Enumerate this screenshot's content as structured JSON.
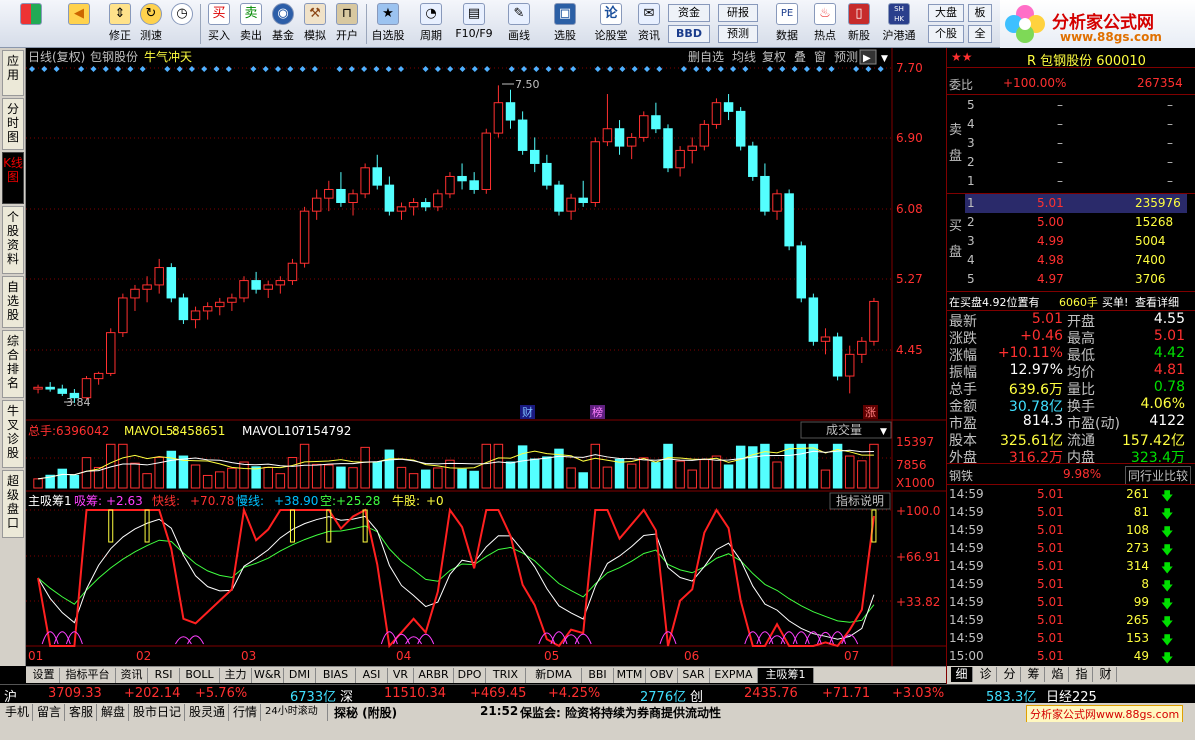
{
  "toolbar": {
    "items": [
      {
        "label": "",
        "icon": "home-grid-icon"
      },
      {
        "label": "",
        "icon": "back-arrow-icon"
      },
      {
        "label": "修正",
        "icon": "arrow-up-icon"
      },
      {
        "label": "测速",
        "icon": "speed-icon"
      },
      {
        "label": "买入",
        "icon": "buy-icon"
      },
      {
        "label": "卖出",
        "icon": "sell-icon"
      },
      {
        "label": "基金",
        "icon": "fund-icon"
      },
      {
        "label": "模拟",
        "icon": "hammer-icon"
      },
      {
        "label": "开户",
        "icon": "lock-icon"
      },
      {
        "label": "自选股",
        "icon": "favorites-icon"
      },
      {
        "label": "周期",
        "icon": "clock-icon"
      },
      {
        "label": "F10/F9",
        "icon": "f10-icon"
      },
      {
        "label": "画线",
        "icon": "pen-icon"
      },
      {
        "label": "选股",
        "icon": "screen-icon"
      },
      {
        "label": "论股堂",
        "icon": "forum-icon"
      },
      {
        "label": "资讯",
        "icon": "news-icon"
      },
      {
        "label": "数据",
        "icon": "data-icon"
      },
      {
        "label": "热点",
        "icon": "fire-icon"
      },
      {
        "label": "新股",
        "icon": "newstock-icon"
      },
      {
        "label": "沪港通",
        "icon": "hk-connect-icon"
      }
    ],
    "small_buttons": [
      "资金",
      "BBD",
      "研报",
      "预测",
      "大盘",
      "个股",
      "板",
      "全"
    ],
    "buy_glyph": "买",
    "sell_glyph": "卖",
    "forum_glyph": "论",
    "hk_glyph": "SH HK",
    "pe_glyph": "PE",
    "bbd_glyph": "BBD"
  },
  "logo": {
    "title": "分析家公式网",
    "url": "www.88gs.com"
  },
  "left_tabs": [
    "应用",
    "分时图",
    "K线图",
    "个股资料",
    "自选股",
    "综合排名",
    "牛叉诊股",
    "超级盘口"
  ],
  "chart": {
    "header_left": "日线(复权)",
    "stock_name": "包钢股份",
    "signal": "牛气冲天",
    "header_right_buttons": [
      "删自选",
      "均线",
      "复权",
      "叠",
      "窗",
      "预测"
    ],
    "high_marker": "7.50",
    "low_marker": "3.84",
    "price_ticks": [
      "7.70",
      "6.90",
      "6.08",
      "5.27",
      "4.45"
    ],
    "event_labels": [
      "财",
      "榜",
      "涨"
    ],
    "volume_header": {
      "label": "总手:",
      "value": "6396042",
      "mavol5_label": "MAVOL5:",
      "mavol5": "8458651",
      "mavol10_label": "MAVOL10:",
      "mavol10": "7154792",
      "dropdown": "成交量"
    },
    "volume_ticks": [
      "15397",
      "7856",
      "X1000"
    ],
    "indicator_header": {
      "name": "主吸筹1",
      "xichou_label": "吸筹:",
      "xichou": "+2.63",
      "kuai_label": "快线:",
      "kuai": "+70.78",
      "man_label": "慢线:",
      "man": "+38.90",
      "kong_label": "空:",
      "kong": "+25.28",
      "niu_label": "牛股:",
      "niu": "+0",
      "help": "指标说明"
    },
    "indicator_ticks": [
      "+100.0",
      "+66.91",
      "+33.82"
    ],
    "month_labels": [
      "01",
      "02",
      "03",
      "04",
      "05",
      "06",
      "07"
    ]
  },
  "chart_data": {
    "type": "candlestick",
    "title": "包钢股份 日线(复权)",
    "ylim": [
      3.6,
      7.8
    ],
    "marked_high": 7.5,
    "marked_low": 3.84,
    "ohlc_approx": [
      [
        4.0,
        4.05,
        3.95,
        4.02
      ],
      [
        4.02,
        4.08,
        3.97,
        4.0
      ],
      [
        4.0,
        4.05,
        3.92,
        3.95
      ],
      [
        3.95,
        4.0,
        3.84,
        3.9
      ],
      [
        3.9,
        4.15,
        3.88,
        4.12
      ],
      [
        4.12,
        4.2,
        4.05,
        4.18
      ],
      [
        4.18,
        4.7,
        4.15,
        4.65
      ],
      [
        4.65,
        5.1,
        4.6,
        5.05
      ],
      [
        5.05,
        5.2,
        4.9,
        5.15
      ],
      [
        5.15,
        5.3,
        5.0,
        5.2
      ],
      [
        5.2,
        5.5,
        5.1,
        5.4
      ],
      [
        5.4,
        5.45,
        5.0,
        5.05
      ],
      [
        5.05,
        5.1,
        4.75,
        4.8
      ],
      [
        4.8,
        4.95,
        4.7,
        4.9
      ],
      [
        4.9,
        5.0,
        4.8,
        4.95
      ],
      [
        4.95,
        5.05,
        4.85,
        5.0
      ],
      [
        5.0,
        5.1,
        4.9,
        5.05
      ],
      [
        5.05,
        5.3,
        5.0,
        5.25
      ],
      [
        5.25,
        5.35,
        5.1,
        5.15
      ],
      [
        5.15,
        5.25,
        5.05,
        5.2
      ],
      [
        5.2,
        5.3,
        5.1,
        5.25
      ],
      [
        5.25,
        5.5,
        5.2,
        5.45
      ],
      [
        5.45,
        6.1,
        5.4,
        6.05
      ],
      [
        6.05,
        6.3,
        5.95,
        6.2
      ],
      [
        6.2,
        6.4,
        6.05,
        6.3
      ],
      [
        6.3,
        6.5,
        6.1,
        6.15
      ],
      [
        6.15,
        6.3,
        6.0,
        6.25
      ],
      [
        6.25,
        6.6,
        6.2,
        6.55
      ],
      [
        6.55,
        6.7,
        6.3,
        6.35
      ],
      [
        6.35,
        6.45,
        6.0,
        6.05
      ],
      [
        6.05,
        6.15,
        5.95,
        6.1
      ],
      [
        6.1,
        6.2,
        6.0,
        6.15
      ],
      [
        6.15,
        6.2,
        6.05,
        6.1
      ],
      [
        6.1,
        6.3,
        6.05,
        6.25
      ],
      [
        6.25,
        6.5,
        6.2,
        6.45
      ],
      [
        6.45,
        6.6,
        6.3,
        6.4
      ],
      [
        6.4,
        6.5,
        6.25,
        6.3
      ],
      [
        6.3,
        7.0,
        6.25,
        6.95
      ],
      [
        6.95,
        7.5,
        6.9,
        7.3
      ],
      [
        7.3,
        7.45,
        7.0,
        7.1
      ],
      [
        7.1,
        7.2,
        6.7,
        6.75
      ],
      [
        6.75,
        6.9,
        6.5,
        6.6
      ],
      [
        6.6,
        6.7,
        6.3,
        6.35
      ],
      [
        6.35,
        6.4,
        6.0,
        6.05
      ],
      [
        6.05,
        6.25,
        5.95,
        6.2
      ],
      [
        6.2,
        6.4,
        6.1,
        6.15
      ],
      [
        6.15,
        6.9,
        6.1,
        6.85
      ],
      [
        6.85,
        7.4,
        6.8,
        7.0
      ],
      [
        7.0,
        7.1,
        6.7,
        6.8
      ],
      [
        6.8,
        6.95,
        6.65,
        6.9
      ],
      [
        6.9,
        7.2,
        6.85,
        7.15
      ],
      [
        7.15,
        7.3,
        6.95,
        7.0
      ],
      [
        7.0,
        7.05,
        6.5,
        6.55
      ],
      [
        6.55,
        6.8,
        6.45,
        6.75
      ],
      [
        6.75,
        6.9,
        6.6,
        6.8
      ],
      [
        6.8,
        7.1,
        6.75,
        7.05
      ],
      [
        7.05,
        7.35,
        7.0,
        7.3
      ],
      [
        7.3,
        7.4,
        7.1,
        7.2
      ],
      [
        7.2,
        7.25,
        6.75,
        6.8
      ],
      [
        6.8,
        6.85,
        6.4,
        6.45
      ],
      [
        6.45,
        6.6,
        6.0,
        6.05
      ],
      [
        6.05,
        6.3,
        5.95,
        6.25
      ],
      [
        6.25,
        6.3,
        5.6,
        5.65
      ],
      [
        5.65,
        5.7,
        5.0,
        5.05
      ],
      [
        5.05,
        5.1,
        4.5,
        4.55
      ],
      [
        4.55,
        4.7,
        4.4,
        4.6
      ],
      [
        4.6,
        4.65,
        4.1,
        4.15
      ],
      [
        4.15,
        4.5,
        3.95,
        4.4
      ],
      [
        4.4,
        4.6,
        4.3,
        4.55
      ],
      [
        4.55,
        5.05,
        4.5,
        5.01
      ]
    ],
    "volume_ylim": [
      0,
      15397
    ]
  },
  "quote": {
    "stock_title": "R 包钢股份 600010",
    "wei_bi_label": "委比",
    "wei_bi": "+100.00%",
    "wei_bi_vol": "267354",
    "sell_label": "卖盘",
    "buy_label": "买盘",
    "sell_levels": [
      {
        "n": "5",
        "price": "–",
        "vol": "–"
      },
      {
        "n": "4",
        "price": "–",
        "vol": "–"
      },
      {
        "n": "3",
        "price": "–",
        "vol": "–"
      },
      {
        "n": "2",
        "price": "–",
        "vol": "–"
      },
      {
        "n": "1",
        "price": "–",
        "vol": "–"
      }
    ],
    "buy_levels": [
      {
        "n": "1",
        "price": "5.01",
        "vol": "235976"
      },
      {
        "n": "2",
        "price": "5.00",
        "vol": "15268"
      },
      {
        "n": "3",
        "price": "4.99",
        "vol": "5004"
      },
      {
        "n": "4",
        "price": "4.98",
        "vol": "7400"
      },
      {
        "n": "5",
        "price": "4.97",
        "vol": "3706"
      }
    ],
    "queue_text": "在买盘4.92位置有",
    "queue_vol": "6060手",
    "queue_buy": "买单!",
    "queue_detail": "查看详细",
    "stats": [
      {
        "l1": "最新",
        "v1": "5.01",
        "l2": "开盘",
        "v2": "4.55",
        "c1": "#ff3030",
        "c2": "#ffffff"
      },
      {
        "l1": "涨跌",
        "v1": "+0.46",
        "l2": "最高",
        "v2": "5.01",
        "c1": "#ff3030",
        "c2": "#ff3030"
      },
      {
        "l1": "涨幅",
        "v1": "+10.11%",
        "l2": "最低",
        "v2": "4.42",
        "c1": "#ff3030",
        "c2": "#00e000"
      },
      {
        "l1": "振幅",
        "v1": "12.97%",
        "l2": "均价",
        "v2": "4.81",
        "c1": "#ffffff",
        "c2": "#ff3030"
      },
      {
        "l1": "总手",
        "v1": "639.6万",
        "l2": "量比",
        "v2": "0.78",
        "c1": "#ffff40",
        "c2": "#00e000"
      },
      {
        "l1": "金额",
        "v1": "30.78亿",
        "l2": "换手",
        "v2": "4.06%",
        "c1": "#40e0ff",
        "c2": "#ffff40"
      },
      {
        "l1": "市盈",
        "v1": "814.3",
        "l2": "市盈(动)",
        "v2": "4122",
        "c1": "#ffffff",
        "c2": "#ffffff"
      },
      {
        "l1": "股本",
        "v1": "325.61亿",
        "l2": "流通",
        "v2": "157.42亿",
        "c1": "#ffff40",
        "c2": "#ffff40"
      },
      {
        "l1": "外盘",
        "v1": "316.2万",
        "l2": "内盘",
        "v2": "323.4万",
        "c1": "#ff3030",
        "c2": "#00e000"
      }
    ],
    "industry": "钢铁",
    "industry_pct": "9.98%",
    "industry_compare": "同行业比较",
    "ticks": [
      {
        "t": "14:59",
        "p": "5.01",
        "v": "261"
      },
      {
        "t": "14:59",
        "p": "5.01",
        "v": "81"
      },
      {
        "t": "14:59",
        "p": "5.01",
        "v": "108"
      },
      {
        "t": "14:59",
        "p": "5.01",
        "v": "273"
      },
      {
        "t": "14:59",
        "p": "5.01",
        "v": "314"
      },
      {
        "t": "14:59",
        "p": "5.01",
        "v": "8"
      },
      {
        "t": "14:59",
        "p": "5.01",
        "v": "99"
      },
      {
        "t": "14:59",
        "p": "5.01",
        "v": "265"
      },
      {
        "t": "14:59",
        "p": "5.01",
        "v": "153"
      },
      {
        "t": "15:00",
        "p": "5.01",
        "v": "49"
      }
    ],
    "right_tabs": [
      "细",
      "诊",
      "分",
      "筹",
      "焰",
      "指",
      "财"
    ]
  },
  "bottom_tabs": [
    "设置",
    "指标平台",
    "资讯",
    "RSI",
    "BOLL",
    "主力",
    "W&R",
    "DMI",
    "BIAS",
    "ASI",
    "VR",
    "ARBR",
    "DPO",
    "TRIX",
    "新DMA",
    "BBI",
    "MTM",
    "OBV",
    "SAR",
    "EXPMA",
    "主吸筹1"
  ],
  "ticker": {
    "sh_label": "沪",
    "sh": "3709.33",
    "sh_chg": "+202.14",
    "sh_pct": "+5.76%",
    "sh_amt": "6733亿",
    "sz_label": "深",
    "sz": "11510.34",
    "sz_chg": "+469.45",
    "sz_pct": "+4.25%",
    "sz_amt": "2776亿",
    "cy_label": "创",
    "cy": "2435.76",
    "cy_chg": "+71.71",
    "cy_pct": "+3.03%",
    "cy_amt": "583.3亿",
    "rj_label": "日经225"
  },
  "status": {
    "items": [
      "手机",
      "留言",
      "客服",
      "解盘",
      "股市日记",
      "股灵通",
      "行情",
      "24小时滚动"
    ],
    "news_tag": "探秘 (附股)",
    "news_time": "21:52",
    "news": "保监会: 险资将持续为券商提供流动性",
    "watermark": "分析家公式网www.88gs.com"
  },
  "colors": {
    "up": "#ff3030",
    "down": "#54ffff",
    "grid": "#800000",
    "bg": "#000000",
    "yellow": "#ffff40",
    "magenta": "#ff40ff"
  }
}
